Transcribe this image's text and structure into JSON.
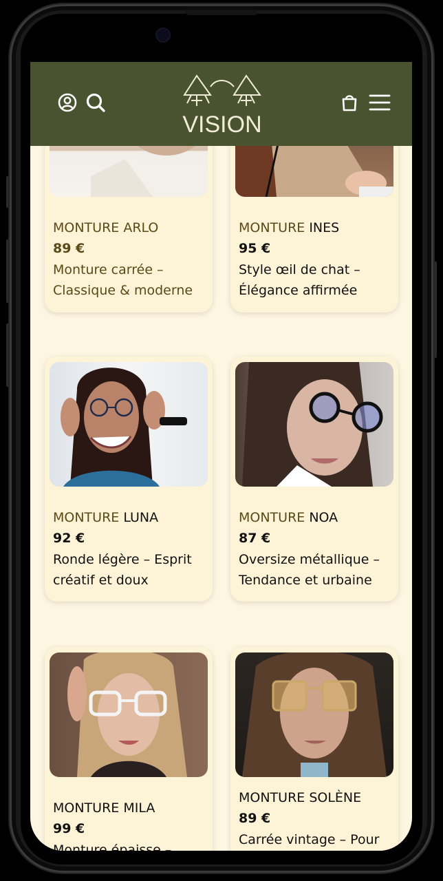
{
  "header": {
    "brand": "VISION",
    "icons": [
      "user-icon",
      "search-icon",
      "bag-icon",
      "menu-icon"
    ],
    "bg_color": "#4a5330"
  },
  "products": [
    {
      "prefix": "MONTURE",
      "name": "ARLO",
      "price": "89 €",
      "desc_line1": "Monture carrée –",
      "desc_line2": "Classique & moderne",
      "accent": true
    },
    {
      "prefix": "MONTURE",
      "name": "INES",
      "price": "95 €",
      "desc_line1": "Style œil de chat –",
      "desc_line2": "Élégance affirmée",
      "accent": false
    },
    {
      "prefix": "MONTURE",
      "name": "LUNA",
      "price": "92 €",
      "desc_line1": "Ronde légère – Esprit",
      "desc_line2": "créatif et doux",
      "accent": false
    },
    {
      "prefix": "MONTURE",
      "name": "NOA",
      "price": "87 €",
      "desc_line1": "Oversize métallique –",
      "desc_line2": "Tendance et urbaine",
      "accent": false
    },
    {
      "prefix": "MONTURE",
      "name": "MILA",
      "price": "99 €",
      "desc_line1": "Monture épaisse –",
      "desc_line2": "",
      "accent": false
    },
    {
      "prefix": "MONTURE",
      "name": "SOLÈNE",
      "price": "89 €",
      "desc_line1": "Carrée vintage – Pour",
      "desc_line2": "",
      "accent": false
    }
  ]
}
